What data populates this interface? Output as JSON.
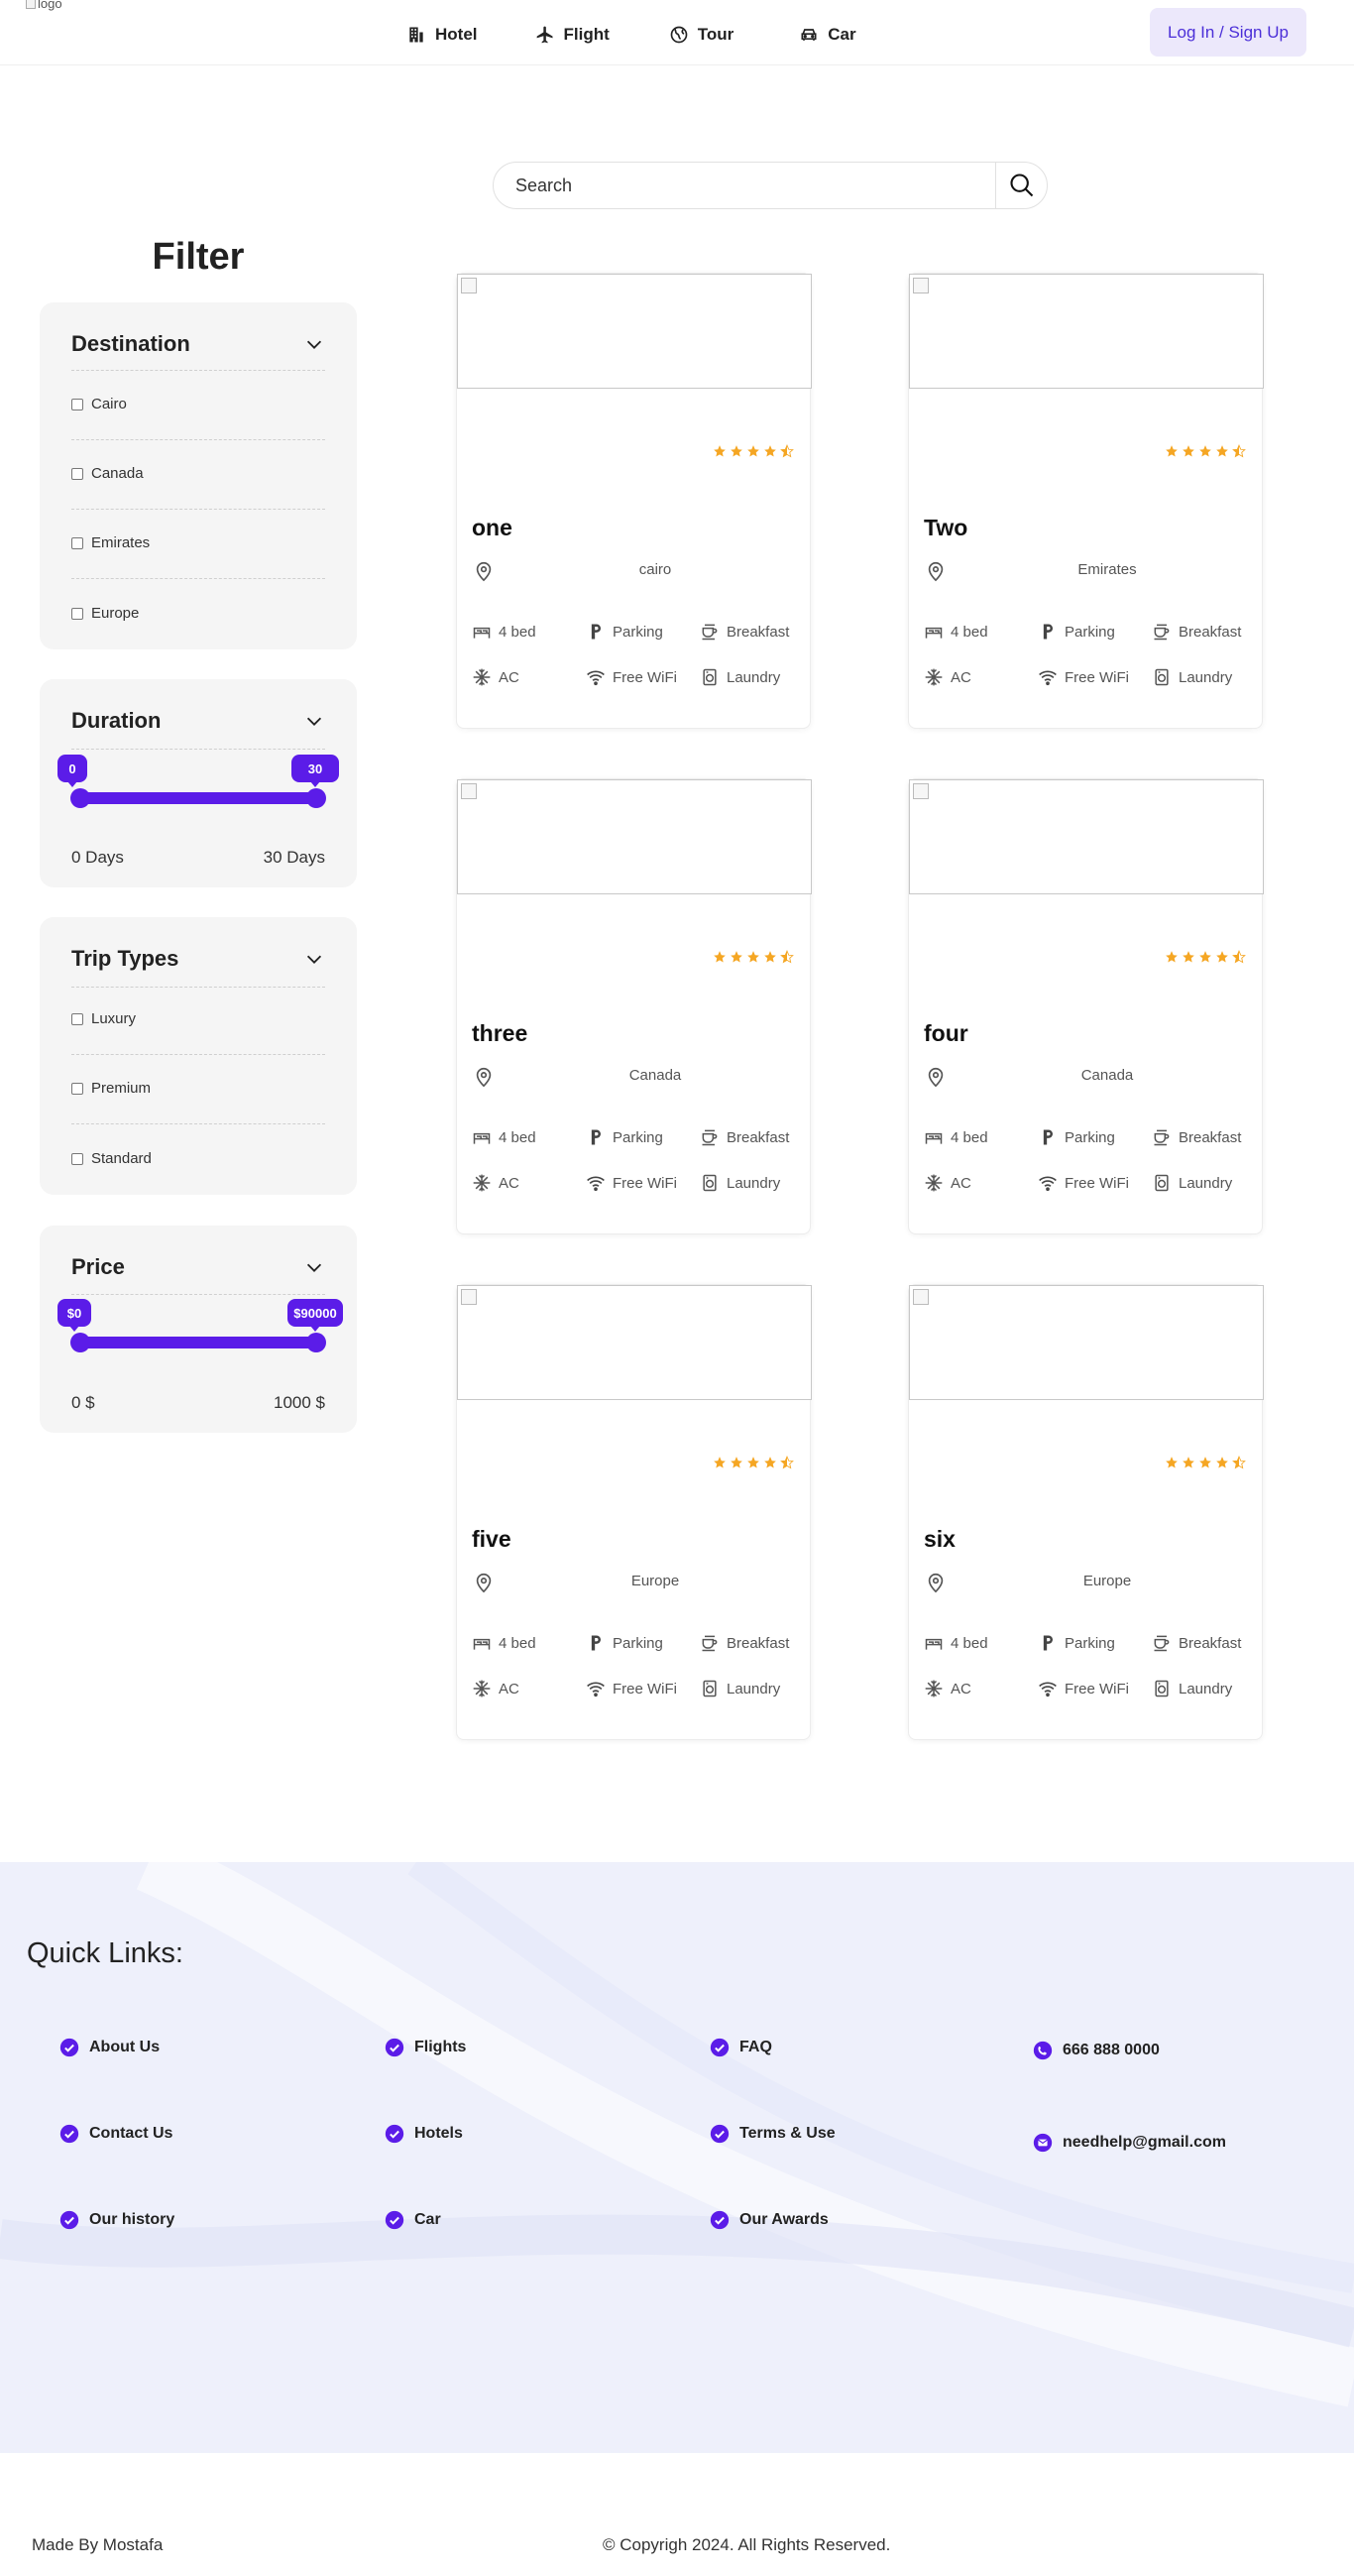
{
  "header": {
    "logo_alt": "logo",
    "nav": [
      {
        "label": "Hotel",
        "icon": "building-icon"
      },
      {
        "label": "Flight",
        "icon": "plane-icon"
      },
      {
        "label": "Tour",
        "icon": "globe-icon"
      },
      {
        "label": "Car",
        "icon": "car-icon"
      }
    ],
    "login_label": "Log In / Sign Up"
  },
  "search": {
    "placeholder": "Search",
    "value": ""
  },
  "filter": {
    "title": "Filter",
    "destination": {
      "title": "Destination",
      "options": [
        "Cairo",
        "Canada",
        "Emirates",
        "Europe"
      ]
    },
    "duration": {
      "title": "Duration",
      "min_bubble": "0",
      "max_bubble": "30",
      "min_label": "0 Days",
      "max_label": "30 Days",
      "selected_fraction": [
        0,
        1
      ]
    },
    "trip_types": {
      "title": "Trip Types",
      "options": [
        "Luxury",
        "Premium",
        "Standard"
      ]
    },
    "price": {
      "title": "Price",
      "min_bubble": "$0",
      "max_bubble": "$90000",
      "min_label": "0 $",
      "max_label": "1000 $",
      "selected_fraction": [
        0,
        1
      ]
    }
  },
  "cards": [
    {
      "name": "one",
      "location": "cairo",
      "rating": 4.5
    },
    {
      "name": "Two",
      "location": "Emirates",
      "rating": 4.5
    },
    {
      "name": "three",
      "location": "Canada",
      "rating": 4.5
    },
    {
      "name": "four",
      "location": "Canada",
      "rating": 4.5
    },
    {
      "name": "five",
      "location": "Europe",
      "rating": 4.5
    },
    {
      "name": "six",
      "location": "Europe",
      "rating": 4.5
    }
  ],
  "amenities": [
    {
      "label": "4 bed",
      "icon": "bed-icon"
    },
    {
      "label": "Parking",
      "icon": "parking-icon"
    },
    {
      "label": "Breakfast",
      "icon": "coffee-icon"
    },
    {
      "label": "AC",
      "icon": "snowflake-icon"
    },
    {
      "label": "Free WiFi",
      "icon": "wifi-icon"
    },
    {
      "label": "Laundry",
      "icon": "laundry-icon"
    }
  ],
  "footer": {
    "quick_links_title": "Quick Links:",
    "links": [
      [
        "About Us",
        "Contact Us",
        "Our history"
      ],
      [
        "Flights",
        "Hotels",
        "Car"
      ],
      [
        "FAQ",
        "Terms & Use",
        "Our Awards"
      ]
    ],
    "phone": "666 888 0000",
    "email": "needhelp@gmail.com",
    "made_by": "Made By Mostafa",
    "copyright": "© Copyrigh 2024. All Rights Reserved."
  },
  "colors": {
    "accent": "#5b1ce8",
    "star": "#f5a623",
    "login_bg": "#ece8fb"
  }
}
